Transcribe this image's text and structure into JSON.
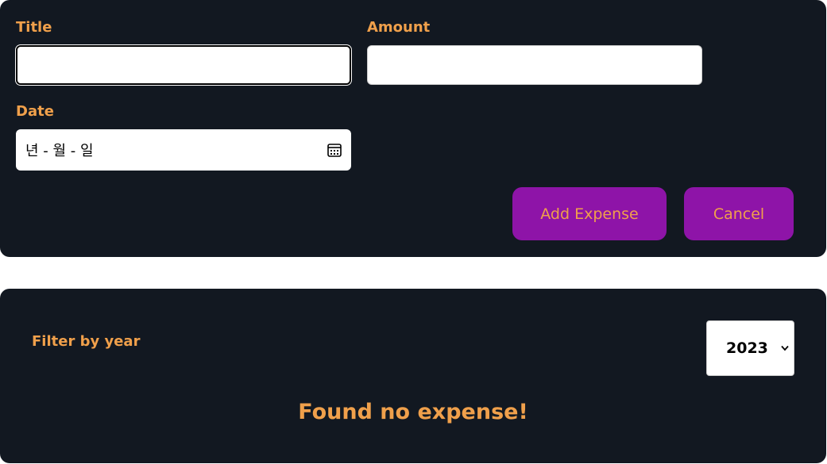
{
  "form": {
    "title_label": "Title",
    "title_value": "",
    "amount_label": "Amount",
    "amount_value": "",
    "date_label": "Date",
    "date_placeholder": "년 - 월 - 일",
    "add_button": "Add Expense",
    "cancel_button": "Cancel"
  },
  "filter": {
    "label": "Filter by year",
    "selected_year": "2023"
  },
  "expenses": {
    "empty_message": "Found no expense!"
  },
  "colors": {
    "panel_bg": "#121821",
    "accent_text": "#f0a04b",
    "button_bg": "#8e14a8"
  }
}
